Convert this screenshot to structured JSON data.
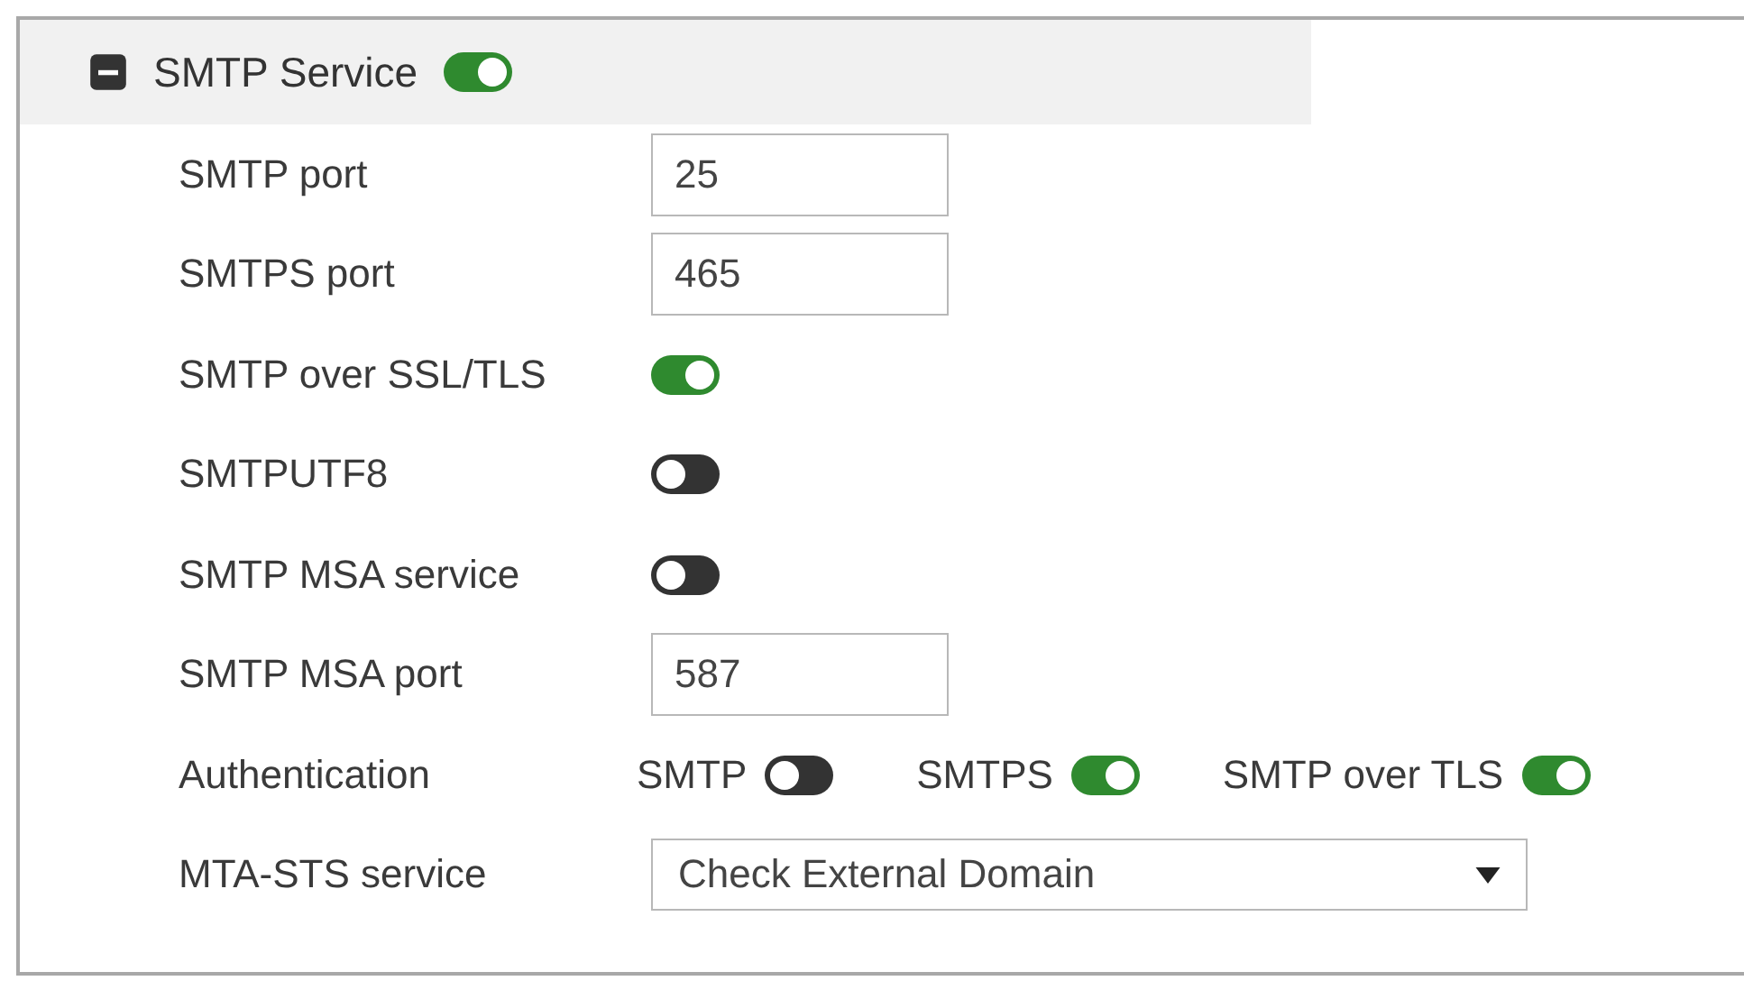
{
  "section": {
    "title": "SMTP Service",
    "expanded": true,
    "enabled": true
  },
  "fields": [
    {
      "kind": "input",
      "label": "SMTP port",
      "value": "25"
    },
    {
      "kind": "input",
      "label": "SMTPS port",
      "value": "465"
    },
    {
      "kind": "toggle",
      "label": "SMTP over SSL/TLS",
      "on": true
    },
    {
      "kind": "toggle",
      "label": "SMTPUTF8",
      "on": false
    },
    {
      "kind": "toggle",
      "label": "SMTP MSA service",
      "on": false
    },
    {
      "kind": "input",
      "label": "SMTP MSA port",
      "value": "587"
    },
    {
      "kind": "multi",
      "label": "Authentication",
      "options": [
        {
          "label": "SMTP",
          "on": false
        },
        {
          "label": "SMTPS",
          "on": true
        },
        {
          "label": "SMTP over TLS",
          "on": true
        }
      ]
    },
    {
      "kind": "select",
      "label": "MTA-STS service",
      "value": "Check External Domain"
    }
  ]
}
